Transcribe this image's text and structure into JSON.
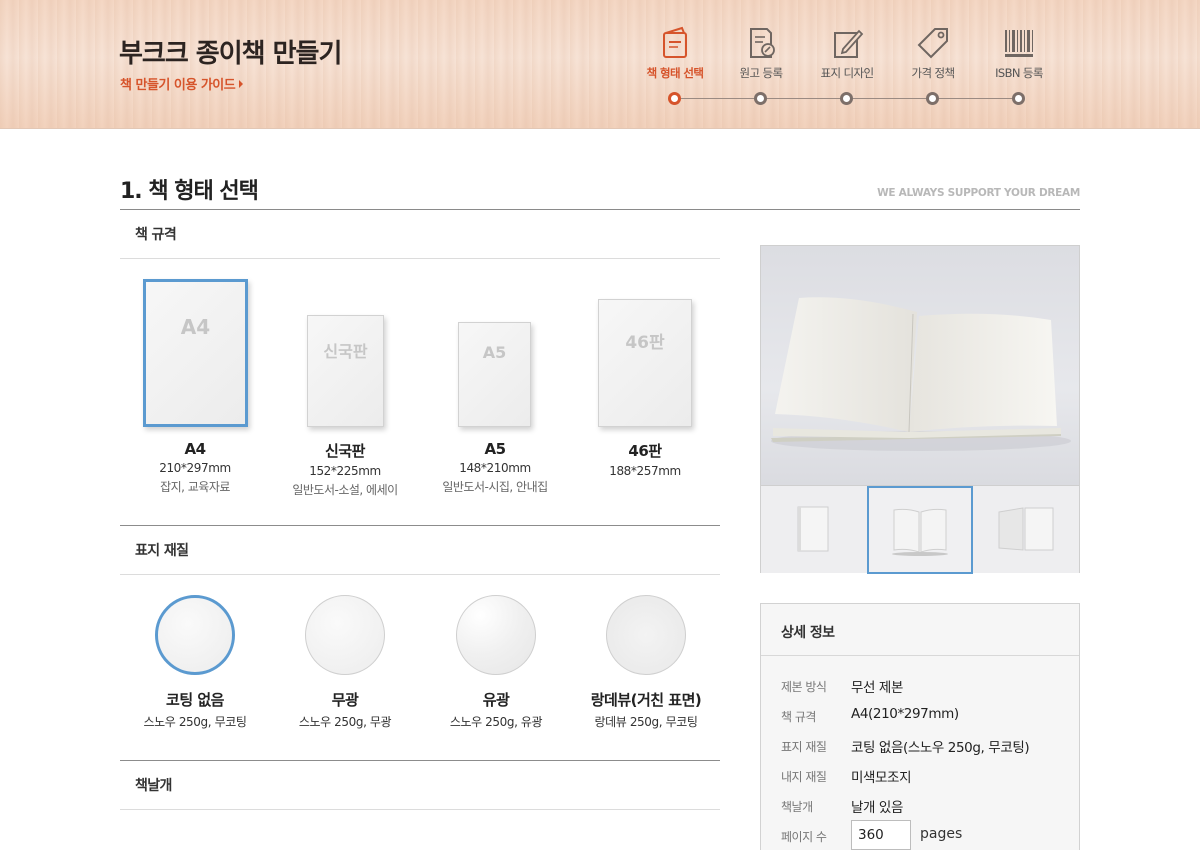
{
  "header": {
    "title": "부크크 종이책 만들기",
    "guide_link": "책 만들기 이용 가이드",
    "steps": [
      {
        "label": "책 형태 선택",
        "icon": "book-icon",
        "active": true
      },
      {
        "label": "원고 등록",
        "icon": "document-icon",
        "active": false
      },
      {
        "label": "표지 디자인",
        "icon": "design-icon",
        "active": false
      },
      {
        "label": "가격 정책",
        "icon": "price-tag-icon",
        "active": false
      },
      {
        "label": "ISBN 등록",
        "icon": "barcode-icon",
        "active": false
      }
    ]
  },
  "section": {
    "title": "1. 책 형태 선택",
    "slogan": "WE ALWAYS SUPPORT YOUR DREAM"
  },
  "size": {
    "heading": "책 규격",
    "options": [
      {
        "card_label": "A4",
        "name": "A4",
        "dims": "210*297mm",
        "use": "잡지, 교육자료",
        "selected": true
      },
      {
        "card_label": "신국판",
        "name": "신국판",
        "dims": "152*225mm",
        "use": "일반도서-소설, 에세이",
        "selected": false
      },
      {
        "card_label": "A5",
        "name": "A5",
        "dims": "148*210mm",
        "use": "일반도서-시집, 안내집",
        "selected": false
      },
      {
        "card_label": "46판",
        "name": "46판",
        "dims": "188*257mm",
        "use": "",
        "selected": false
      }
    ]
  },
  "cover": {
    "heading": "표지 재질",
    "options": [
      {
        "name": "코팅 없음",
        "desc": "스노우 250g, 무코팅",
        "selected": true
      },
      {
        "name": "무광",
        "desc": "스노우 250g, 무광",
        "selected": false
      },
      {
        "name": "유광",
        "desc": "스노우 250g, 유광",
        "selected": false
      },
      {
        "name": "랑데뷰(거친 표면)",
        "desc": "랑데뷰 250g, 무코팅",
        "selected": false
      }
    ]
  },
  "flap": {
    "heading": "책날개"
  },
  "detail": {
    "heading": "상세 정보",
    "rows": [
      {
        "key": "제본 방식",
        "value": "무선 제본"
      },
      {
        "key": "책 규격",
        "value": "A4(210*297mm)"
      },
      {
        "key": "표지 재질",
        "value": "코팅 없음(스노우 250g, 무코팅)"
      },
      {
        "key": "내지 재질",
        "value": "미색모조지"
      },
      {
        "key": "책날개",
        "value": "날개 있음"
      },
      {
        "key": "페이지 수",
        "value": ""
      }
    ],
    "pages_value": "360",
    "pages_unit": "pages"
  },
  "colors": {
    "accent": "#d6542b",
    "selection": "#5b9ad0"
  }
}
